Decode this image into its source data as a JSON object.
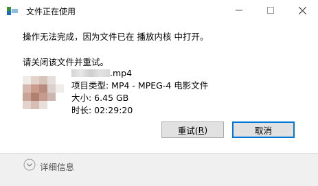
{
  "window": {
    "title": "文件正在使用"
  },
  "titlebar": {
    "minimize_glyph": "—",
    "maximize_glyph": "☐",
    "close_glyph": "✕"
  },
  "message": {
    "line1": "操作无法完成，因为文件已在 播放内核 中打开。",
    "line2": "请关闭该文件并重试。"
  },
  "file": {
    "name_suffix": ".mp4",
    "type": "项目类型: MP4 - MPEG-4 电影文件",
    "size": "大小: 6.45 GB",
    "duration": "时长: 02:29:20"
  },
  "buttons": {
    "retry_text": "重试(",
    "retry_key": "R",
    "retry_close": ")",
    "cancel": "取消"
  },
  "footer": {
    "details": "详细信息"
  },
  "colors": {
    "accent": "#0078d7",
    "button_bg": "#e1e1e1",
    "footer_bg": "#f0f0f0"
  },
  "icons": {
    "app": "file-in-use-icon",
    "details": "chevron-down-icon"
  }
}
